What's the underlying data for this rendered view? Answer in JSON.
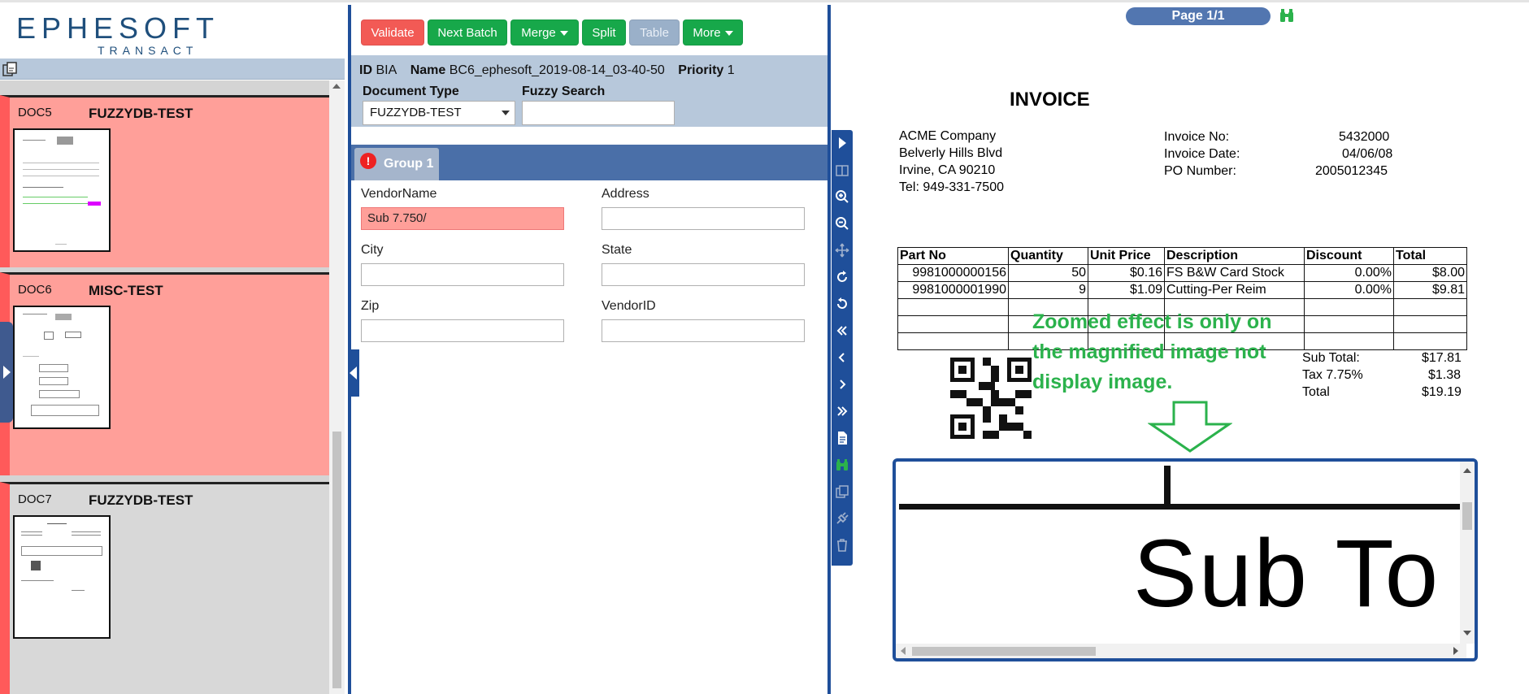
{
  "logo": {
    "top": "EPHESOFT",
    "bottom": "TRANSACT"
  },
  "documents": [
    {
      "id": "DOC5",
      "type": "FUZZYDB-TEST",
      "state": "error"
    },
    {
      "id": "DOC6",
      "type": "MISC-TEST",
      "state": "error"
    },
    {
      "id": "DOC7",
      "type": "FUZZYDB-TEST",
      "state": "normal"
    }
  ],
  "toolbar": {
    "validate": "Validate",
    "next_batch": "Next Batch",
    "merge": "Merge",
    "split": "Split",
    "table": "Table",
    "more": "More"
  },
  "batch": {
    "id_label": "ID",
    "id_value": "BIA",
    "name_label": "Name",
    "name_value": "BC6_ephesoft_2019-08-14_03-40-50",
    "priority_label": "Priority",
    "priority_value": "1",
    "doc_type_label": "Document Type",
    "doc_type_value": "FUZZYDB-TEST",
    "fuzzy_label": "Fuzzy Search",
    "fuzzy_value": ""
  },
  "group": {
    "label": "Group 1",
    "error_glyph": "!"
  },
  "fields": {
    "vendor_name": {
      "label": "VendorName",
      "value": "Sub 7.750/"
    },
    "address": {
      "label": "Address",
      "value": ""
    },
    "city": {
      "label": "City",
      "value": ""
    },
    "state": {
      "label": "State",
      "value": ""
    },
    "zip": {
      "label": "Zip",
      "value": ""
    },
    "vendor_id": {
      "label": "VendorID",
      "value": ""
    }
  },
  "viewer": {
    "page": "Page 1/1",
    "annotation": "Zoomed effect is only on the magnified image not display image.",
    "magnified_text": "Sub To"
  },
  "invoice": {
    "title": "INVOICE",
    "company": [
      "ACME Company",
      "Belverly Hills Blvd",
      "Irvine, CA 90210",
      "Tel: 949-331-7500"
    ],
    "info_labels": [
      "Invoice No:",
      "Invoice Date:",
      "PO Number:"
    ],
    "info_values": [
      "5432000",
      "04/06/08",
      "2005012345"
    ],
    "table_headers": [
      "Part No",
      "Quantity",
      "Unit Price",
      "Description",
      "Discount",
      "Total"
    ],
    "table_rows": [
      [
        "9981000000156",
        "50",
        "$0.16",
        "FS B&W Card Stock",
        "0.00%",
        "$8.00"
      ],
      [
        "9981000001990",
        "9",
        "$1.09",
        "Cutting-Per Reim",
        "0.00%",
        "$9.81"
      ]
    ],
    "totals_labels": [
      "Sub Total:",
      "Tax 7.75%",
      "Total"
    ],
    "totals_values": [
      "$17.81",
      "$1.38",
      "$19.19"
    ]
  },
  "colors": {
    "brand_blue": "#1f4f9a",
    "error_red": "#ff9f99",
    "validate_red": "#f25a55",
    "action_green": "#17a84a",
    "annotation_green": "#2bb24c"
  }
}
